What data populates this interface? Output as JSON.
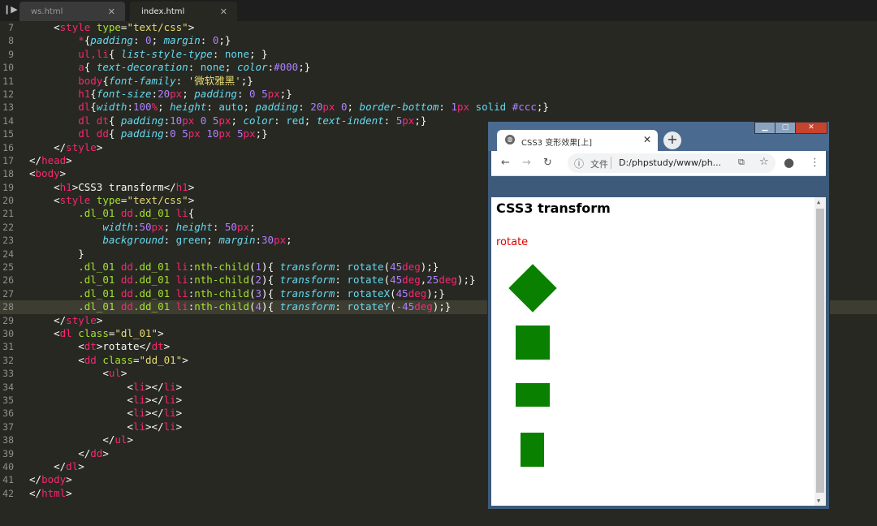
{
  "editor": {
    "tabs": [
      {
        "label": "ws.html"
      },
      {
        "label": "index.html"
      }
    ],
    "lines": [
      {
        "n": "7"
      },
      {
        "n": "8"
      },
      {
        "n": "9"
      },
      {
        "n": "10"
      },
      {
        "n": "11"
      },
      {
        "n": "12"
      },
      {
        "n": "13"
      },
      {
        "n": "14"
      },
      {
        "n": "15"
      },
      {
        "n": "16"
      },
      {
        "n": "17"
      },
      {
        "n": "18"
      },
      {
        "n": "19"
      },
      {
        "n": "20"
      },
      {
        "n": "21"
      },
      {
        "n": "22"
      },
      {
        "n": "23"
      },
      {
        "n": "24"
      },
      {
        "n": "25"
      },
      {
        "n": "26"
      },
      {
        "n": "27"
      },
      {
        "n": "28"
      },
      {
        "n": "29"
      },
      {
        "n": "30"
      },
      {
        "n": "31"
      },
      {
        "n": "32"
      },
      {
        "n": "33"
      },
      {
        "n": "34"
      },
      {
        "n": "35"
      },
      {
        "n": "36"
      },
      {
        "n": "37"
      },
      {
        "n": "38"
      },
      {
        "n": "39"
      },
      {
        "n": "40"
      },
      {
        "n": "41"
      },
      {
        "n": "42"
      }
    ],
    "code": {
      "l7_tag": "style",
      "l7_attr": "type",
      "l7_val": "\"text/css\"",
      "l8_sel": "*",
      "l8_p1": "padding",
      "l8_v1": "0",
      "l8_p2": "margin",
      "l8_v2": "0",
      "l9_sel": "ul,li",
      "l9_p1": "list-style-type",
      "l9_v1": "none",
      "l10_sel": "a",
      "l10_p1": "text-decoration",
      "l10_v1": "none",
      "l10_p2": "color",
      "l10_v2": "#000",
      "l11_sel": "body",
      "l11_p1": "font-family",
      "l11_v1": "'微软雅黑'",
      "l12_sel": "h1",
      "l12_p1": "font-size",
      "l12_v1": "20",
      "l12_p2": "padding",
      "l12_v2a": "0",
      "l12_v2b": "5",
      "l13_sel": "dl",
      "l13_p1": "width",
      "l13_v1": "100",
      "l13_p2": "height",
      "l13_v2": "auto",
      "l13_p3": "padding",
      "l13_v3a": "20",
      "l13_v3b": "0",
      "l13_p4": "border-bottom",
      "l13_v4a": "1",
      "l13_v4b": "solid",
      "l13_v4c": "#ccc",
      "l14_sel": "dl dt",
      "l14_p1": "padding",
      "l14_v1a": "10",
      "l14_v1b": "0",
      "l14_v1c": "5",
      "l14_p2": "color",
      "l14_v2": "red",
      "l14_p3": "text-indent",
      "l14_v3": "5",
      "l15_sel": "dl dd",
      "l15_p1": "padding",
      "l15_v1a": "0",
      "l15_v1b": "5",
      "l15_v1c": "10",
      "l15_v1d": "5",
      "l16_tag": "style",
      "l17_tag": "head",
      "l18_tag": "body",
      "l19_tag": "h1",
      "l19_text": "CSS3 transform",
      "l20_tag": "style",
      "l20_attr": "type",
      "l20_val": "\"text/css\"",
      "l21_c1": ".dl_01",
      "l21_c2": "dd",
      "l21_c3": ".dd_01",
      "l21_c4": "li",
      "l22_p1": "width",
      "l22_v1": "50",
      "l22_p2": "height",
      "l22_v2": "50",
      "l23_p1": "background",
      "l23_v1": "green",
      "l23_p2": "margin",
      "l23_v2": "30",
      "l25_fn": "rotate",
      "l25_n": "1",
      "l25_arg": "45",
      "l26_fn": "rotate",
      "l26_n": "2",
      "l26_arg1": "45",
      "l26_arg2": "25",
      "l27_fn": "rotateX",
      "l27_n": "3",
      "l27_arg": "45",
      "l28_fn": "rotateY",
      "l28_n": "4",
      "l28_arg": "-45",
      "l29_tag": "style",
      "l30_tag": "dl",
      "l30_attr": "class",
      "l30_val": "\"dl_01\"",
      "l31_tag": "dt",
      "l31_text": "rotate",
      "l32_tag": "dd",
      "l32_attr": "class",
      "l32_val": "\"dd_01\"",
      "l33_tag": "ul",
      "li_tag": "li",
      "l38_tag": "ul",
      "l39_tag": "dd",
      "l40_tag": "dl",
      "l41_tag": "body",
      "l42_tag": "html",
      "unit_px": "px",
      "unit_pct": "%",
      "unit_deg": "deg",
      "prop_transform": "transform",
      "nth": "nth-child"
    }
  },
  "browser": {
    "tab_title": "CSS3 变形效果[上]",
    "tab_close": "✕",
    "new_tab": "+",
    "address_file_label": "文件",
    "address_url": "D:/phpstudy/www/ph...",
    "page": {
      "heading": "CSS3 transform",
      "dt_text": "rotate"
    },
    "colors": {
      "box": "#008000",
      "dt": "#ff0000"
    }
  }
}
